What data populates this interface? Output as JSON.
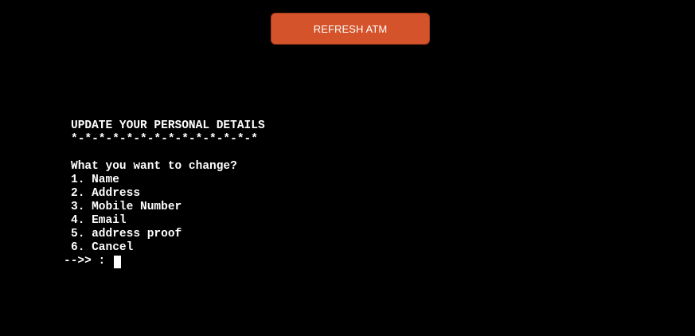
{
  "toolbar": {
    "refresh_label": "REFRESH ATM"
  },
  "terminal": {
    "title": "UPDATE YOUR PERSONAL DETAILS",
    "separator": "*-*-*-*-*-*-*-*-*-*-*-*-*-*",
    "question": "What you want to change?",
    "options": [
      "1. Name",
      "2. Address",
      "3. Mobile Number",
      "4. Email",
      "5. address proof",
      "6. Cancel"
    ],
    "prompt": "-->> : "
  },
  "colors": {
    "background": "#000000",
    "button": "#d4532a",
    "text": "#ffffff"
  }
}
